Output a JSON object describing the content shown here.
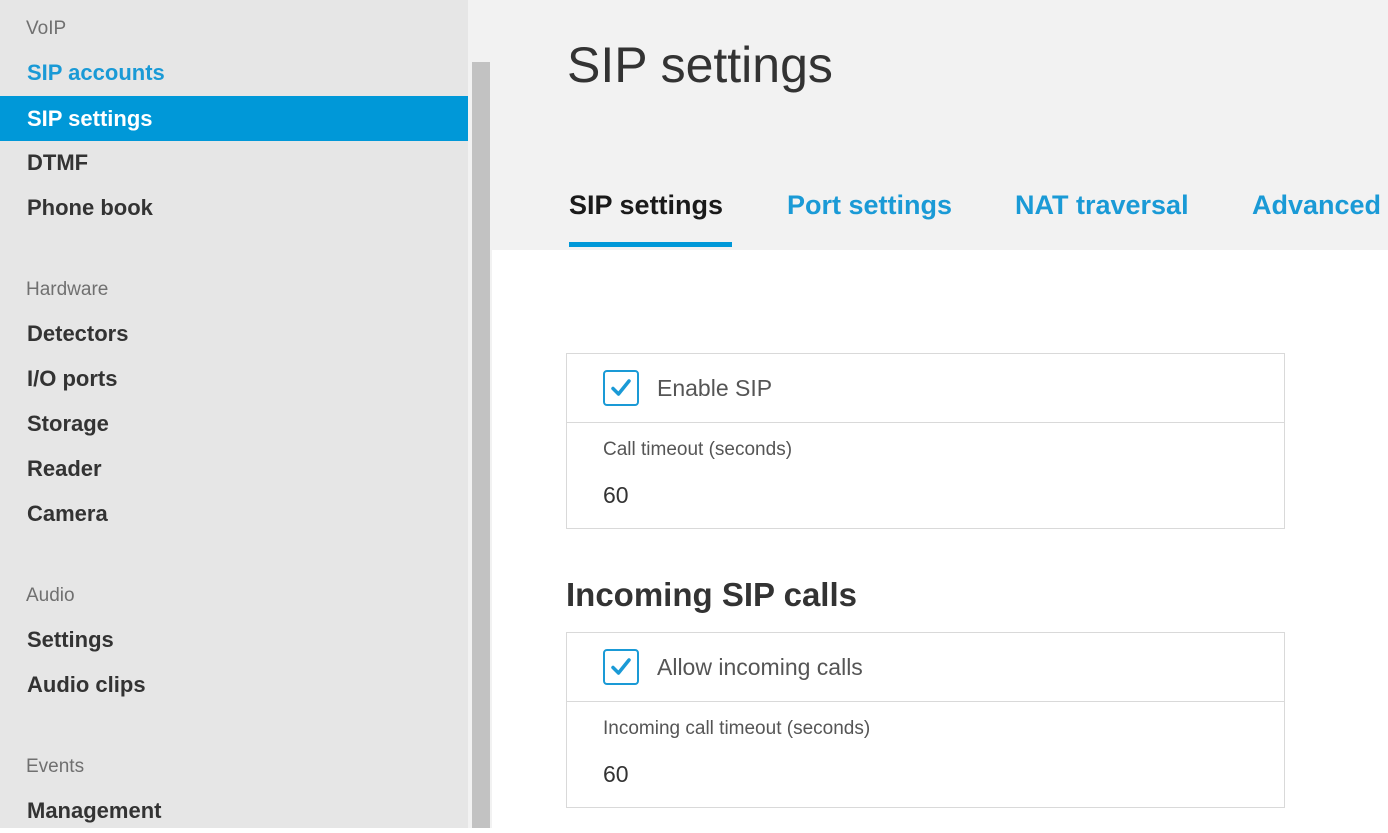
{
  "sidebar": {
    "groups": [
      {
        "header": "VoIP",
        "items": [
          "SIP accounts",
          "SIP settings",
          "DTMF",
          "Phone book"
        ]
      },
      {
        "header": "Hardware",
        "items": [
          "Detectors",
          "I/O ports",
          "Storage",
          "Reader",
          "Camera"
        ]
      },
      {
        "header": "Audio",
        "items": [
          "Settings",
          "Audio clips"
        ]
      },
      {
        "header": "Events",
        "items": [
          "Management"
        ]
      }
    ],
    "active_item": "SIP settings",
    "link_item": "SIP accounts"
  },
  "page": {
    "title": "SIP settings"
  },
  "tabs": [
    "SIP settings",
    "Port settings",
    "NAT traversal",
    "Advanced"
  ],
  "active_tab": "SIP settings",
  "general": {
    "enable_sip_label": "Enable SIP",
    "enable_sip_checked": true,
    "call_timeout_label": "Call timeout (seconds)",
    "call_timeout_value": "60"
  },
  "incoming": {
    "title": "Incoming SIP calls",
    "allow_label": "Allow incoming calls",
    "allow_checked": true,
    "timeout_label": "Incoming call timeout (seconds)",
    "timeout_value": "60"
  },
  "colors": {
    "accent": "#0098d8",
    "link": "#1a9ad6",
    "sidebar_bg": "#e6e6e6",
    "header_bg": "#f2f2f2"
  },
  "icons": {
    "checkbox": "check-icon"
  }
}
